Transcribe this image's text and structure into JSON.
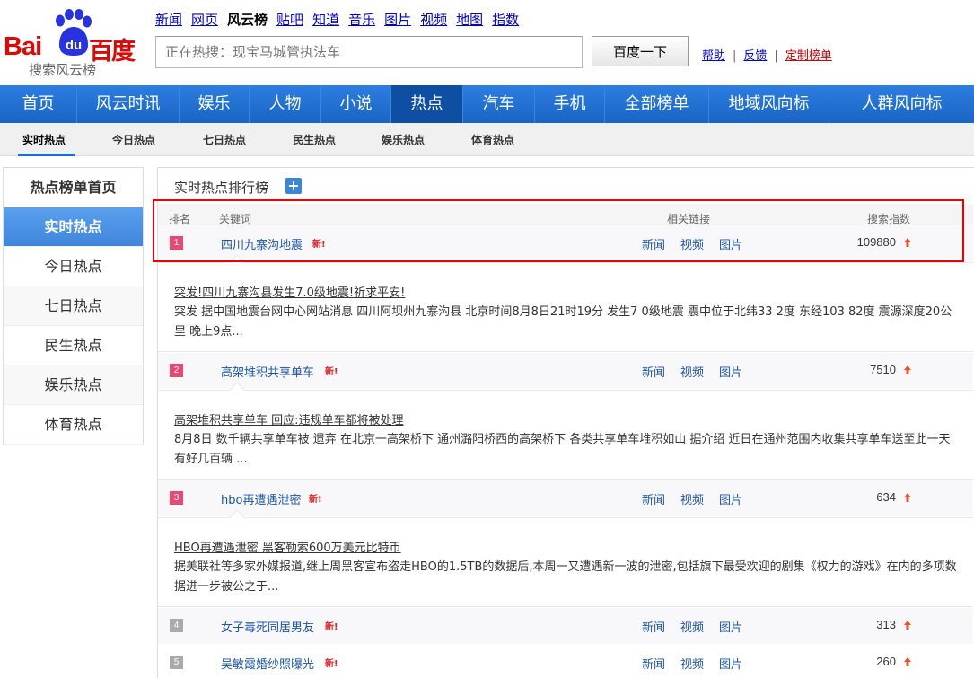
{
  "logo": {
    "bai": "Bai",
    "du": "du",
    "baidu_cn": "百度",
    "sub": "搜索风云榜"
  },
  "topnav": [
    "新闻",
    "网页",
    "风云榜",
    "贴吧",
    "知道",
    "音乐",
    "图片",
    "视频",
    "地图",
    "指数"
  ],
  "topnav_current": "风云榜",
  "search": {
    "placeholder": "正在热搜：现宝马城管执法车",
    "button": "百度一下"
  },
  "toplinks": {
    "help": "帮助",
    "feedback": "反馈",
    "custom": "定制榜单",
    "sep": "|"
  },
  "mainnav": [
    "首页",
    "风云时讯",
    "娱乐",
    "人物",
    "小说",
    "热点",
    "汽车",
    "手机",
    "全部榜单",
    "地域风向标",
    "人群风向标"
  ],
  "mainnav_active": "热点",
  "subnav": [
    "实时热点",
    "今日热点",
    "七日热点",
    "民生热点",
    "娱乐热点",
    "体育热点"
  ],
  "sidebar": [
    "热点榜单首页",
    "实时热点",
    "今日热点",
    "七日热点",
    "民生热点",
    "娱乐热点",
    "体育热点"
  ],
  "main": {
    "title": "实时热点排行榜",
    "plus": "+",
    "headers": {
      "rank": "排名",
      "keyword": "关键词",
      "links": "相关链接",
      "index": "搜索指数"
    },
    "link_labels": {
      "news": "新闻",
      "video": "视频",
      "image": "图片"
    },
    "new_tag": "新!",
    "rows": [
      {
        "rank": "1",
        "keyword": "四川九寨沟地震",
        "index": "109880"
      },
      {
        "rank": "2",
        "keyword": "高架堆积共享单车",
        "index": "7510"
      },
      {
        "rank": "3",
        "keyword": "hbo再遭遇泄密",
        "index": "634"
      },
      {
        "rank": "4",
        "keyword": "女子毒死同居男友",
        "index": "313"
      },
      {
        "rank": "5",
        "keyword": "吴敏霞婚纱照曝光",
        "index": "260"
      }
    ],
    "details": [
      {
        "title": "突发!四川九寨沟县发生7.0级地震!祈求平安!",
        "text": "突发 据中国地震台网中心网站消息 四川阿坝州九寨沟县 北京时间8月8日21时19分 发生7 0级地震 震中位于北纬33 2度 东经103 82度 震源深度20公里 晚上9点..."
      },
      {
        "title": "高架堆积共享单车 回应:违规单车都将被处理",
        "text": "8月8日 数千辆共享单车被 遗弃 在北京一高架桥下 通州潞阳桥西的高架桥下 各类共享单车堆积如山 据介绍 近日在通州范围内收集共享单车送至此一天有好几百辆 ..."
      },
      {
        "title": "HBO再遭遇泄密 黑客勒索600万美元比特币",
        "text": "据美联社等多家外媒报道,继上周黑客宣布盗走HBO的1.5TB的数据后,本周一又遭遇新一波的泄密,包括旗下最受欢迎的剧集《权力的游戏》在内的多项数据进一步被公之于..."
      }
    ]
  },
  "colors": {
    "nav_blue": "#1e6fd2",
    "rank_hot": "#e74973",
    "rank_cool": "#aaaaaa",
    "link": "#1b55a8",
    "highlight": "#ee0000",
    "arrow": "#e8532f"
  }
}
